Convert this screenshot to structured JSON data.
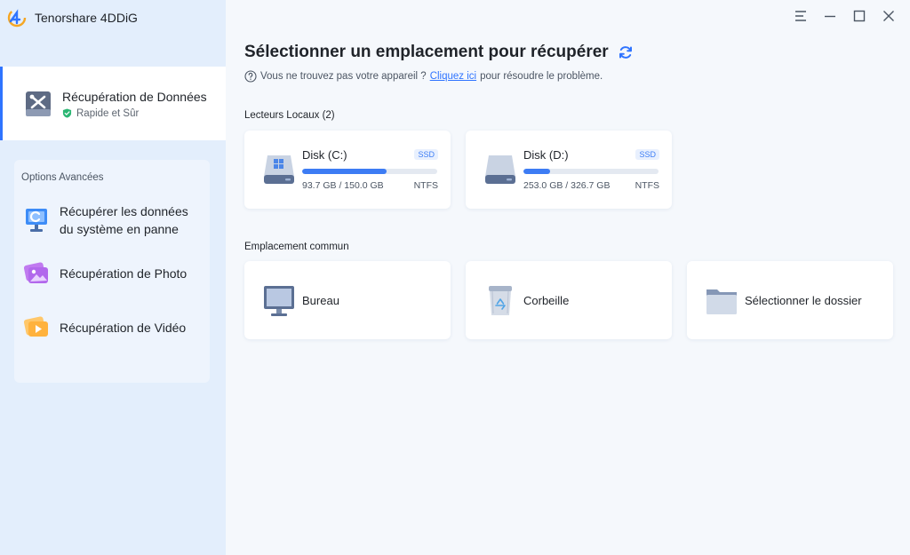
{
  "app": {
    "name": "Tenorshare 4DDiG",
    "logo_icon": "4ddig-logo-icon"
  },
  "sidebar": {
    "primary": {
      "title": "Récupération de Données",
      "subtitle": "Rapide et Sûr",
      "icon": "tools-drive-icon"
    },
    "advanced": {
      "title": "Options Avancées",
      "items": [
        {
          "label_line1": "Récupérer les données",
          "label_line2": "du système en panne",
          "icon": "crashed-computer-icon"
        },
        {
          "label": "Récupération de Photo",
          "icon": "photo-icon"
        },
        {
          "label": "Récupération de Vidéo",
          "icon": "video-icon"
        }
      ]
    }
  },
  "window_controls": [
    "menu-icon",
    "minimize-icon",
    "maximize-icon",
    "close-icon"
  ],
  "main": {
    "title": "Sélectionner un emplacement pour récupérer",
    "help": {
      "before": "Vous ne trouvez pas votre appareil ?",
      "link": "Cliquez ici",
      "after": "pour résoudre le problème."
    },
    "local_drives": {
      "label": "Lecteurs Locaux (2)",
      "disks": [
        {
          "name": "Disk (C:)",
          "badge": "SSD",
          "capacity": "93.7 GB / 150.0 GB",
          "fs": "NTFS",
          "used_fraction": 0.625,
          "icon": "windows-drive-icon"
        },
        {
          "name": "Disk (D:)",
          "badge": "SSD",
          "capacity": "253.0 GB / 326.7 GB",
          "fs": "NTFS",
          "used_fraction": 0.2,
          "icon": "drive-icon"
        }
      ]
    },
    "common": {
      "label": "Emplacement commun",
      "items": [
        {
          "label": "Bureau",
          "icon": "desktop-monitor-icon"
        },
        {
          "label": "Corbeille",
          "icon": "recycle-bin-icon"
        },
        {
          "label": "Sélectionner le dossier",
          "icon": "folder-icon"
        }
      ]
    }
  },
  "colors": {
    "accent": "#2f74ff",
    "sidebar_bg": "#e3eefc",
    "main_bg": "#f5f8fc",
    "progress": "#3d7cf4",
    "success": "#2bb673"
  }
}
